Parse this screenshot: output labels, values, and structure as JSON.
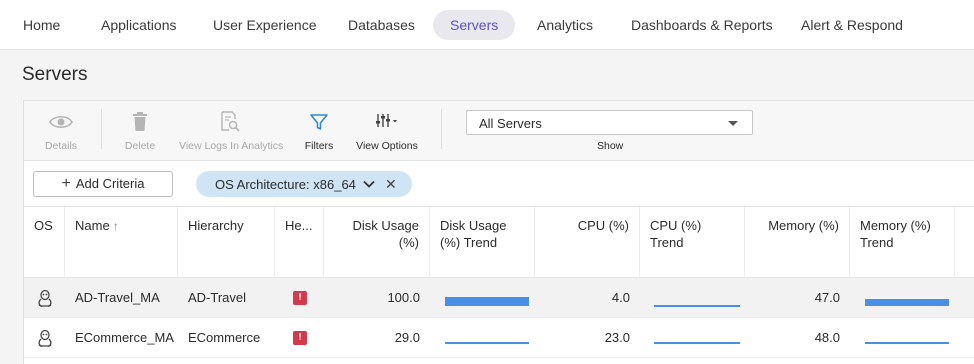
{
  "nav": {
    "items": [
      {
        "label": "Home"
      },
      {
        "label": "Applications"
      },
      {
        "label": "User Experience"
      },
      {
        "label": "Databases"
      },
      {
        "label": "Servers"
      },
      {
        "label": "Analytics"
      },
      {
        "label": "Dashboards & Reports"
      },
      {
        "label": "Alert & Respond"
      }
    ],
    "active": "Servers"
  },
  "page": {
    "title": "Servers"
  },
  "toolbar": {
    "details": {
      "label": "Details",
      "icon": "eye-icon"
    },
    "delete": {
      "label": "Delete",
      "icon": "trash-icon"
    },
    "view_logs": {
      "label": "View Logs In Analytics",
      "icon": "log-search-icon"
    },
    "filters": {
      "label": "Filters",
      "icon": "filter-icon"
    },
    "view_options": {
      "label": "View Options",
      "icon": "sliders-icon"
    },
    "server_select": {
      "value": "All Servers"
    },
    "show_label": "Show"
  },
  "criteria": {
    "add_label": "Add Criteria",
    "chip": {
      "label": "OS Architecture: x86_64"
    }
  },
  "table": {
    "columns": {
      "os": "OS",
      "name": "Name",
      "hierarchy": "Hierarchy",
      "health": "He...",
      "disk_usage": "Disk Usage (%)",
      "disk_usage_trend": "Disk Usage (%) Trend",
      "cpu": "CPU (%)",
      "cpu_trend": "CPU (%) Trend",
      "memory": "Memory (%)",
      "memory_trend": "Memory (%) Trend"
    },
    "rows": [
      {
        "os_icon": "linux-icon",
        "name": "AD-Travel_MA",
        "hierarchy": "AD-Travel",
        "health": "!",
        "disk_usage": "100.0",
        "cpu": "4.0",
        "memory": "47.0"
      },
      {
        "os_icon": "linux-icon",
        "name": "ECommerce_MA",
        "hierarchy": "ECommerce",
        "health": "!",
        "disk_usage": "29.0",
        "cpu": "23.0",
        "memory": "48.0"
      }
    ]
  },
  "colors": {
    "accent": "#5a4fcf",
    "filter_blue": "#2f8bd8",
    "chip_bg": "#cfe4f5",
    "health_critical": "#d63a4a",
    "trend_bar": "#4a8fe6"
  }
}
